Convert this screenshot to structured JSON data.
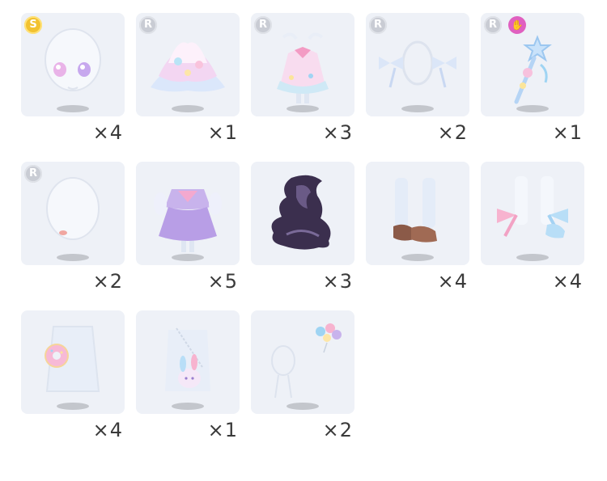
{
  "items": [
    {
      "rarity": "S",
      "count": "×4",
      "art": "face-eyes-icon",
      "skill": false
    },
    {
      "rarity": "R",
      "count": "×1",
      "art": "frilly-top-icon",
      "skill": false
    },
    {
      "rarity": "R",
      "count": "×3",
      "art": "pastel-dress-icon",
      "skill": false
    },
    {
      "rarity": "R",
      "count": "×2",
      "art": "hair-bows-icon",
      "skill": false
    },
    {
      "rarity": "R",
      "count": "×1",
      "art": "star-wand-icon",
      "skill": true
    },
    {
      "rarity": "R",
      "count": "×2",
      "art": "face-mouth-icon",
      "skill": false
    },
    {
      "rarity": "",
      "count": "×5",
      "art": "sailor-dress-icon",
      "skill": false
    },
    {
      "rarity": "",
      "count": "×3",
      "art": "dark-shadow-icon",
      "skill": false
    },
    {
      "rarity": "",
      "count": "×4",
      "art": "brown-shoes-icon",
      "skill": false
    },
    {
      "rarity": "",
      "count": "×4",
      "art": "ribbon-shoes-icon",
      "skill": false
    },
    {
      "rarity": "",
      "count": "×4",
      "art": "donut-bag-icon",
      "skill": false
    },
    {
      "rarity": "",
      "count": "×1",
      "art": "bunny-bag-icon",
      "skill": false
    },
    {
      "rarity": "",
      "count": "×2",
      "art": "balloons-icon",
      "skill": false
    }
  ],
  "colors": {
    "card": "#eef1f7",
    "badge_r": "#c9ccd4",
    "badge_s": "#f2c230",
    "badge_skill": "#e060c0"
  }
}
